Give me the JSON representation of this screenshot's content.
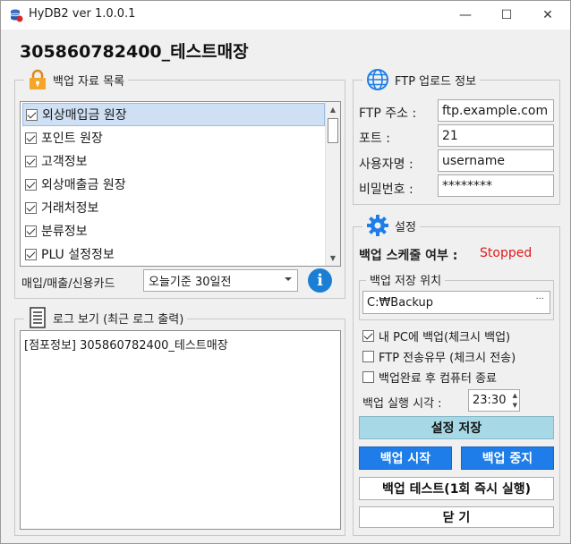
{
  "window": {
    "title": "HyDB2 ver 1.0.0.1",
    "minimize": "—",
    "maximize": "☐",
    "close": "✕"
  },
  "page_title": "305860782400_테스트매장",
  "backup_data": {
    "legend": "백업 자료 목록",
    "items": [
      {
        "label": "외상매입금 원장",
        "checked": true,
        "selected": true
      },
      {
        "label": "포인트 원장",
        "checked": true
      },
      {
        "label": "고객정보",
        "checked": true
      },
      {
        "label": "외상매출금 원장",
        "checked": true
      },
      {
        "label": "거래처정보",
        "checked": true
      },
      {
        "label": "분류정보",
        "checked": true
      },
      {
        "label": "PLU 설정정보",
        "checked": true
      }
    ],
    "card_label": "매입/매출/신용카드",
    "card_combo_value": "오늘기준 30일전"
  },
  "log": {
    "legend": "로그 보기 (최근 로그 출력)",
    "lines": [
      "[점포정보] 305860782400_테스트매장"
    ]
  },
  "ftp": {
    "legend": "FTP 업로드 정보",
    "address_label": "FTP 주소 :",
    "address_value": "ftp.example.com",
    "port_label": "포트 :",
    "port_value": "21",
    "user_label": "사용자명 :",
    "user_value": "username",
    "password_label": "비밀번호 :",
    "password_value": "********"
  },
  "settings": {
    "legend": "설정",
    "schedule_label": "백업 스케줄 여부 :",
    "schedule_status": "Stopped",
    "location_legend": "백업 저장 위치",
    "location_value": "C:₩Backup",
    "location_browse": "···",
    "opt_pc_backup": "내 PC에 백업(체크시 백업)",
    "opt_pc_backup_checked": true,
    "opt_ftp": "FTP 전송유무 (체크시 전송)",
    "opt_ftp_checked": false,
    "opt_shutdown": "백업완료 후 컴퓨터 종료",
    "opt_shutdown_checked": false,
    "time_label": "백업 실행 시각 :",
    "time_value": "23:30",
    "save_button": "설정 저장",
    "start_button": "백업 시작",
    "stop_button": "백업 중지",
    "test_button": "백업 테스트(1회 즉시 실행)",
    "close_button": "닫 기"
  },
  "colors": {
    "accent_blue": "#1e7de8",
    "save_button": "#a7d8e6",
    "status_red": "#e01b1b"
  }
}
